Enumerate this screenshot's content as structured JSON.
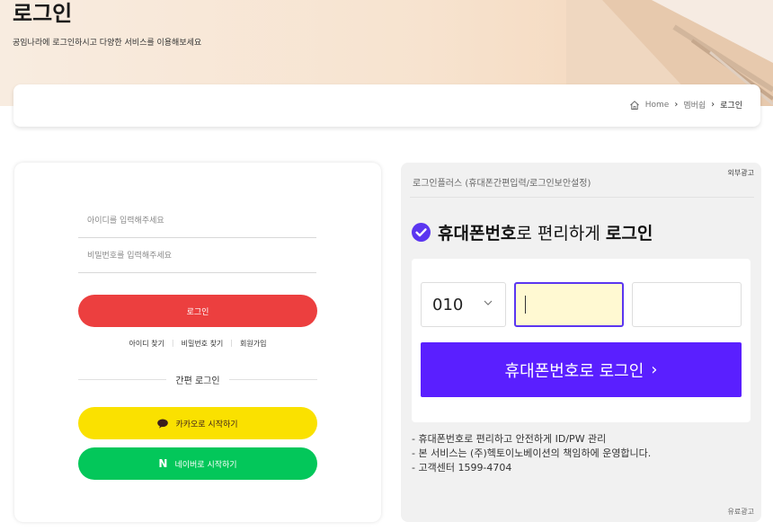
{
  "header": {
    "title": "로그인",
    "subtitle": "공임나라에 로그인하시고 다양한 서비스를 이용해보세요"
  },
  "breadcrumb": {
    "home": "Home",
    "sep": "›",
    "membership": "멤버쉽",
    "current": "로그인"
  },
  "login": {
    "id_placeholder": "아이디를 입력해주세요",
    "pw_placeholder": "비밀번호를 입력해주세요",
    "login_button": "로그인",
    "find_id": "아이디 찾기",
    "find_pw": "비밀번호 찾기",
    "signup": "회원가입",
    "link_sep": "|",
    "simple_login": "간편 로그인",
    "kakao_button": "카카오로 시작하기",
    "naver_button": "네이버로 시작하기",
    "naver_logo": "N"
  },
  "phone_login": {
    "panel_title": "로그인플러스 (휴대폰간편입력/로그인보안설정)",
    "ad_label_top": "외부광고",
    "headline_bold": "휴대폰번호",
    "headline_mid": "로 편리하게 ",
    "headline_end": "로그인",
    "prefix_value": "010",
    "submit_button": "휴대폰번호로 로그인",
    "submit_arrow": "›",
    "notes": [
      "- 휴대폰번호로 편리하고 안전하게 ID/PW 관리",
      "- 본 서비스는 (주)헥토이노베이션의 책임하에 운영합니다.",
      "- 고객센터 1599-4704"
    ],
    "ad_label_bottom": "유료광고"
  },
  "colors": {
    "login_red": "#ec3f3f",
    "kakao_yellow": "#fae100",
    "naver_green": "#03c75a",
    "phone_purple": "#5a1fff",
    "check_purple": "#5b36f0",
    "input_highlight": "#fff9d2"
  },
  "icons": {
    "home": "home-icon",
    "kakao": "speech-bubble-icon",
    "check": "check-circle-icon",
    "chevron": "chevron-down-icon"
  }
}
